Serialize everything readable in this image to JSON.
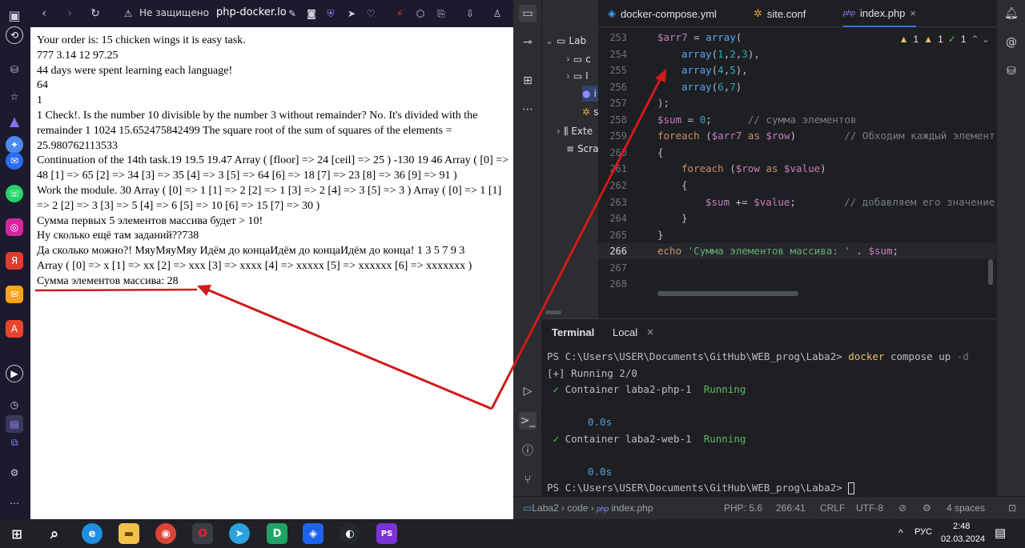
{
  "browser": {
    "security_label": "Не защищено",
    "url": "php-docker.lo"
  },
  "page_lines": [
    "Your order is: 15 chicken wings it is easy task.",
    "777 3.14 12 97.25",
    "44 days were spent learning each language!",
    "64",
    "1",
    "1 Check!. Is the number 10 divisible by the number 3 without remainder? No. It's divided with the remainder 1 1024 15.652475842499 The square root of the sum of squares of the elements = 25.980762113533",
    "Continuation of the 14th task.19 19.5 19.47 Array ( [floor] => 24 [ceil] => 25 ) -130 19 46 Array ( [0] => 48 [1] => 65 [2] => 34 [3] => 35 [4] => 3 [5] => 64 [6] => 18 [7] => 23 [8] => 36 [9] => 91 )",
    "Work the module. 30 Array ( [0] => 1 [1] => 2 [2] => 1 [3] => 2 [4] => 3 [5] => 3 ) Array ( [0] => 1 [1] => 2 [2] => 3 [3] => 5 [4] => 6 [5] => 10 [6] => 15 [7] => 30 )",
    "Сумма первых 5 элементов массива будет > 10!",
    "Ну сколько ещё там заданий??738",
    "Да сколько можно?! МяуМяуМяу Идём до концаИдём до концаИдём до конца! 1 3 5 7 9 3",
    "Array ( [0] => x [1] => xx [2] => xxx [3] => xxxx [4] => xxxxx [5] => xxxxxx [6] => xxxxxxx )",
    "Сумма элементов массива: 28"
  ],
  "ide": {
    "tabs": [
      {
        "label": "docker-compose.yml"
      },
      {
        "label": "site.conf"
      },
      {
        "label": "index.php"
      }
    ],
    "project_root": "Lab",
    "project_items": [
      "c",
      "I",
      "i",
      "s",
      "Exte",
      "Scra"
    ],
    "inspections": {
      "warnings": "1",
      "weak": "1",
      "ok": "1"
    },
    "line_numbers": [
      "253",
      "254",
      "255",
      "256",
      "257",
      "258",
      "259",
      "260",
      "261",
      "262",
      "263",
      "264",
      "265",
      "266",
      "267",
      "268"
    ],
    "code": {
      "l253": {
        "v": "$arr7",
        "op": " = ",
        "fn": "array",
        "rest": "("
      },
      "l254": {
        "fn": "array",
        "a": "1",
        "b": "2",
        "c": "3"
      },
      "l255": {
        "fn": "array",
        "a": "4",
        "b": "5"
      },
      "l256": {
        "fn": "array",
        "a": "6",
        "b": "7"
      },
      "l257": ");",
      "l258": {
        "v": "$sum",
        "num": "0",
        "com": "// сумма элементов"
      },
      "l259": {
        "kw": "foreach",
        "v1": "$arr7",
        "as": "as",
        "v2": "$row",
        "com": "// Обходим каждый элемент"
      },
      "l260": "{",
      "l261": {
        "kw": "foreach",
        "v1": "$row",
        "as": "as",
        "v2": "$value"
      },
      "l262": "{",
      "l263": {
        "v1": "$sum",
        "v2": "$value",
        "com": "// добавляем его значение"
      },
      "l264": "}",
      "l265": "}",
      "l266": {
        "kw": "echo",
        "str": "'Сумма элементов массива: '",
        "v": "$sum"
      }
    },
    "terminal": {
      "tab_title": "Terminal",
      "local_tab": "Local",
      "lines": {
        "prompt1": "PS C:\\Users\\USER\\Documents\\GitHub\\WEB_prog\\Laba2>",
        "cmd_docker": "docker",
        "cmd_rest": "compose up",
        "cmd_flag": "-d",
        "running": "[+] Running 2/0",
        "c1_name": "Container laba2-php-1",
        "c1_status": "Running",
        "c1_time": "0.0s",
        "c2_name": "Container laba2-web-1",
        "c2_status": "Running",
        "c2_time": "0.0s",
        "prompt2": "PS C:\\Users\\USER\\Documents\\GitHub\\WEB_prog\\Laba2>"
      }
    },
    "statusbar": {
      "path_project": "Laba2",
      "path_dir": "code",
      "path_file": "index.php",
      "php_version": "PHP: 5.6",
      "position": "266:41",
      "line_sep": "CRLF",
      "encoding": "UTF-8",
      "indent": "4 spaces"
    }
  },
  "taskbar": {
    "language": "РУС",
    "time": "2:48",
    "date": "02.03.2024"
  },
  "colors": {
    "annotation_red": "#d11a1a",
    "ide_bg": "#1e1f22",
    "accent": "#3574f0"
  }
}
